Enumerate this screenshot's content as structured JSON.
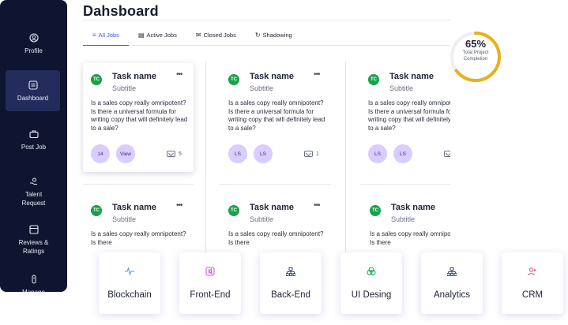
{
  "sidebar": {
    "items": [
      {
        "label": "Profile",
        "icon": "profile-icon"
      },
      {
        "label": "Dashboard",
        "icon": "dashboard-icon"
      },
      {
        "label": "Post Job",
        "icon": "briefcase-icon"
      },
      {
        "label": "Talent Request",
        "icon": "hand-icon"
      },
      {
        "label": "Reviews & Ratings",
        "icon": "reviews-icon"
      },
      {
        "label": "Manage",
        "icon": "manage-icon"
      }
    ],
    "active": "Dashboard"
  },
  "header": {
    "title": "Dahsboard"
  },
  "tabs": [
    {
      "label": "All Jobs",
      "icon": "list-icon"
    },
    {
      "label": "Active Jobs",
      "icon": "calendar-icon"
    },
    {
      "label": "Closed Jobs",
      "icon": "mail-icon"
    },
    {
      "label": "Shadowing",
      "icon": "refresh-icon"
    }
  ],
  "progress": {
    "percent": "65%",
    "value": 0.65,
    "label": "Total Project Completion",
    "color": "#e8b019"
  },
  "cards": [
    {
      "avatar": "TC",
      "name": "Task name",
      "subtitle": "Subtitle",
      "menu": "•••",
      "desc": "Is a sales copy really omnipotent? Is there a universal formula for writing copy that will definitely lead to a sale?",
      "pill1": "14",
      "pill2": "View",
      "count": "5"
    },
    {
      "avatar": "TC",
      "name": "Task name",
      "subtitle": "Subtitle",
      "menu": "•••",
      "desc": "Is a sales copy really omnipotent? Is there a universal formula for writing copy that will definitely lead to a sale?",
      "pill1": "LS",
      "pill2": "LS",
      "count": "1"
    },
    {
      "avatar": "TC",
      "name": "Task name",
      "subtitle": "Subtitle",
      "menu": "•••",
      "desc": "Is a sales copy really omnipotent? Is there a universal formula for writing copy that will definitely lead to a sale?",
      "pill1": "LS",
      "pill2": "LS",
      "count": ""
    },
    {
      "avatar": "TC",
      "name": "Task name",
      "subtitle": "Subtitle",
      "menu": "•••",
      "desc": "Is a sales copy really omnipotent? Is there"
    },
    {
      "avatar": "TC",
      "name": "Task name",
      "subtitle": "Subtitle",
      "menu": "•••",
      "desc": "Is a sales copy really omnipotent? Is there"
    },
    {
      "avatar": "TC",
      "name": "Task name",
      "subtitle": "Subtitle",
      "menu": "",
      "desc": "Is a sales copy really omnipotent? Is there"
    }
  ],
  "categories": [
    {
      "label": "Blockchain",
      "icon": "pulse-icon",
      "color": "#5b8def"
    },
    {
      "label": "Front-End",
      "icon": "frontend-icon",
      "color": "#d255e6"
    },
    {
      "label": "Back-End",
      "icon": "hierarchy-icon",
      "color": "#3b4a8c"
    },
    {
      "label": "UI Desing",
      "icon": "circles-icon",
      "color": "#1ea84f"
    },
    {
      "label": "Analytics",
      "icon": "hierarchy-icon",
      "color": "#3b4a8c"
    },
    {
      "label": "CRM",
      "icon": "user-add-icon",
      "color": "#e0457b"
    }
  ]
}
